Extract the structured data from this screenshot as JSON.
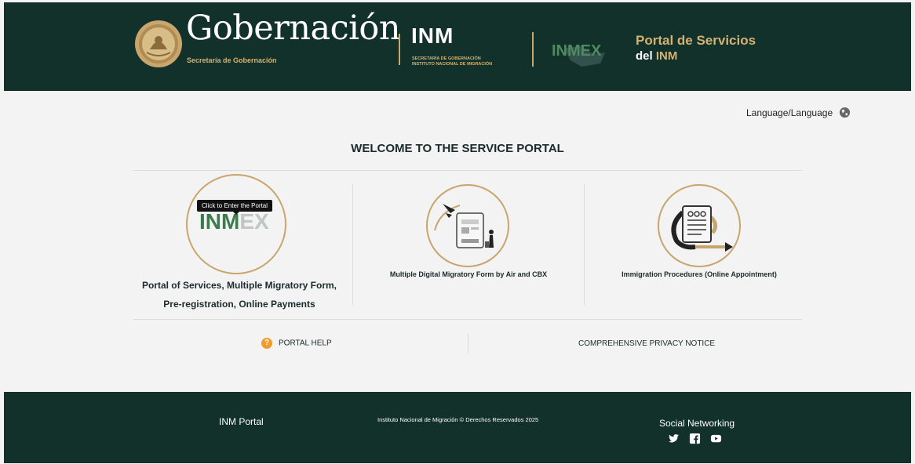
{
  "header": {
    "gob_title": "Gobernación",
    "gob_subtitle": "Secretaría de Gobernación",
    "inm_logo": "INM",
    "inm_subtitle_line1": "SECRETARÍA DE GOBERNACIÓN",
    "inm_subtitle_line2": "INSTITUTO NACIONAL DE MIGRACIÓN",
    "inmex_logo": "INMEX",
    "portal_title": "Portal de Servicios",
    "portal_subtitle_prefix": "del",
    "portal_subtitle_strong": "INM"
  },
  "language": {
    "label": "Language/Language",
    "icon": "globe-icon"
  },
  "welcome": "WELCOME TO THE SERVICE PORTAL",
  "cards": [
    {
      "tooltip": "Click to Enter the Portal",
      "logo_main": "INM",
      "logo_ex": "EX",
      "label_line1": "Portal of Services, Multiple Migratory Form,",
      "label_line2": "Pre-registration, Online Payments",
      "icon": "inmex-logo-icon"
    },
    {
      "label": "Multiple Digital Migratory Form by Air and CBX",
      "icon": "airplane-form-icon"
    },
    {
      "label": "Immigration Procedures (Online Appointment)",
      "icon": "appointment-document-icon"
    }
  ],
  "links": {
    "help_icon_glyph": "?",
    "help": "PORTAL HELP",
    "privacy": "COMPREHENSIVE PRIVACY NOTICE"
  },
  "footer": {
    "portal": "INM Portal",
    "copyright": "Instituto Nacional de Migración © Derechos Reservados 2025",
    "social_title": "Social Networking",
    "social": [
      "twitter-icon",
      "facebook-icon",
      "youtube-icon"
    ]
  },
  "colors": {
    "header_bg": "#12312b",
    "gold": "#c8a56d",
    "help_orange": "#f09b2a",
    "page_bg": "#f3f3f3"
  }
}
